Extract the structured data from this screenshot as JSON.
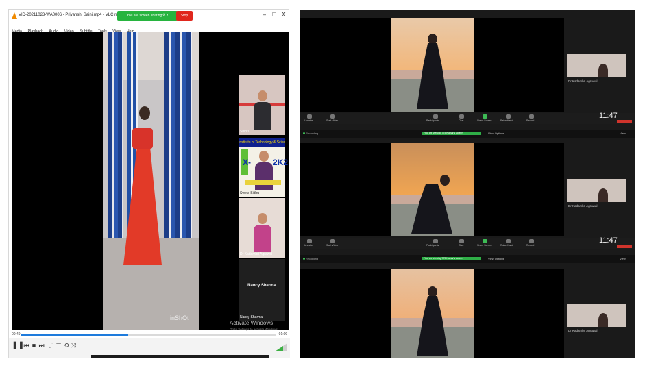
{
  "vlc": {
    "title": "VID-20211023-WA0006 - Priyanshi Saini.mp4 - VLC media player",
    "share_label": "You are screen sharing",
    "stop_share_label": "Stop Share",
    "window_controls": [
      "–",
      "□",
      "X"
    ],
    "menu": [
      "Media",
      "Playback",
      "Audio",
      "Video",
      "Subtitle",
      "Tools",
      "View",
      "Help"
    ],
    "time_elapsed": "00:49",
    "time_remaining": "-01:09",
    "playback_progress": 0.42,
    "video_watermark": "inShOt",
    "activate_text": "Activate Windows",
    "activate_sub": "Go to Settings to activate Windows."
  },
  "participants": [
    {
      "name": "Shipra"
    },
    {
      "name": "Sweta Sidhu",
      "banner": "Institute of Technology & Science",
      "banner_text": "X-PRESS 2K21",
      "sub": "Inter-College Fest-2021"
    },
    {
      "name": "Dr Kadambri Agrawal"
    },
    {
      "name": "Nancy Sharma",
      "center_label": "Nancy Sharma"
    }
  ],
  "zoom": {
    "clock": "11:47",
    "recording_label": "Recording",
    "sharing_label": "You are viewing 775 Kumar's screen",
    "view_options": "View Options",
    "view_label": "View",
    "thumb_name": "Dr Kadambri Agrawal",
    "toolbar": [
      "Unmute",
      "Start Video",
      "Participants",
      "Chat",
      "Share Screen",
      "Raise Hand",
      "Record"
    ]
  },
  "colors": {
    "share_green": "#27b43f",
    "stop_red": "#e0271d",
    "seek_blue": "#1e7bdc",
    "zoom_bg": "#1a1a1a"
  }
}
